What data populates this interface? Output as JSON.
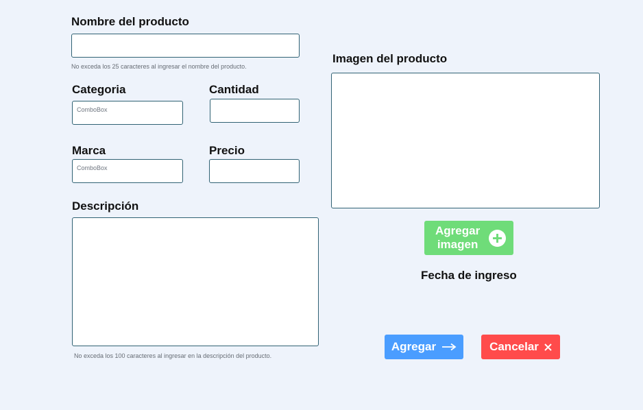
{
  "form": {
    "name_label": "Nombre del producto",
    "name_hint": "No exceda los 25 caracteres al ingresar el nombre del producto.",
    "category_label": "Categoria",
    "category_value": "ComboBox",
    "quantity_label": "Cantidad",
    "brand_label": "Marca",
    "brand_value": "ComboBox",
    "price_label": "Precio",
    "description_label": "Descripción",
    "description_hint": "No exceda los 100 caracteres al ingresar en la descripción del producto.",
    "image_label": "Imagen del producto",
    "add_image_label_line1": "Agregar",
    "add_image_label_line2": "imagen",
    "date_label": "Fecha de ingreso",
    "submit_label": "Agregar",
    "cancel_label": "Cancelar"
  },
  "colors": {
    "page_bg": "#eef3fb",
    "input_border": "#2f6173",
    "add_image_btn": "#6fdc79",
    "submit_btn": "#4a9dff",
    "cancel_btn": "#ff4b4b"
  },
  "icons": {
    "add_image": "plus-circle-icon",
    "submit": "arrow-right-icon",
    "cancel": "close-icon"
  }
}
